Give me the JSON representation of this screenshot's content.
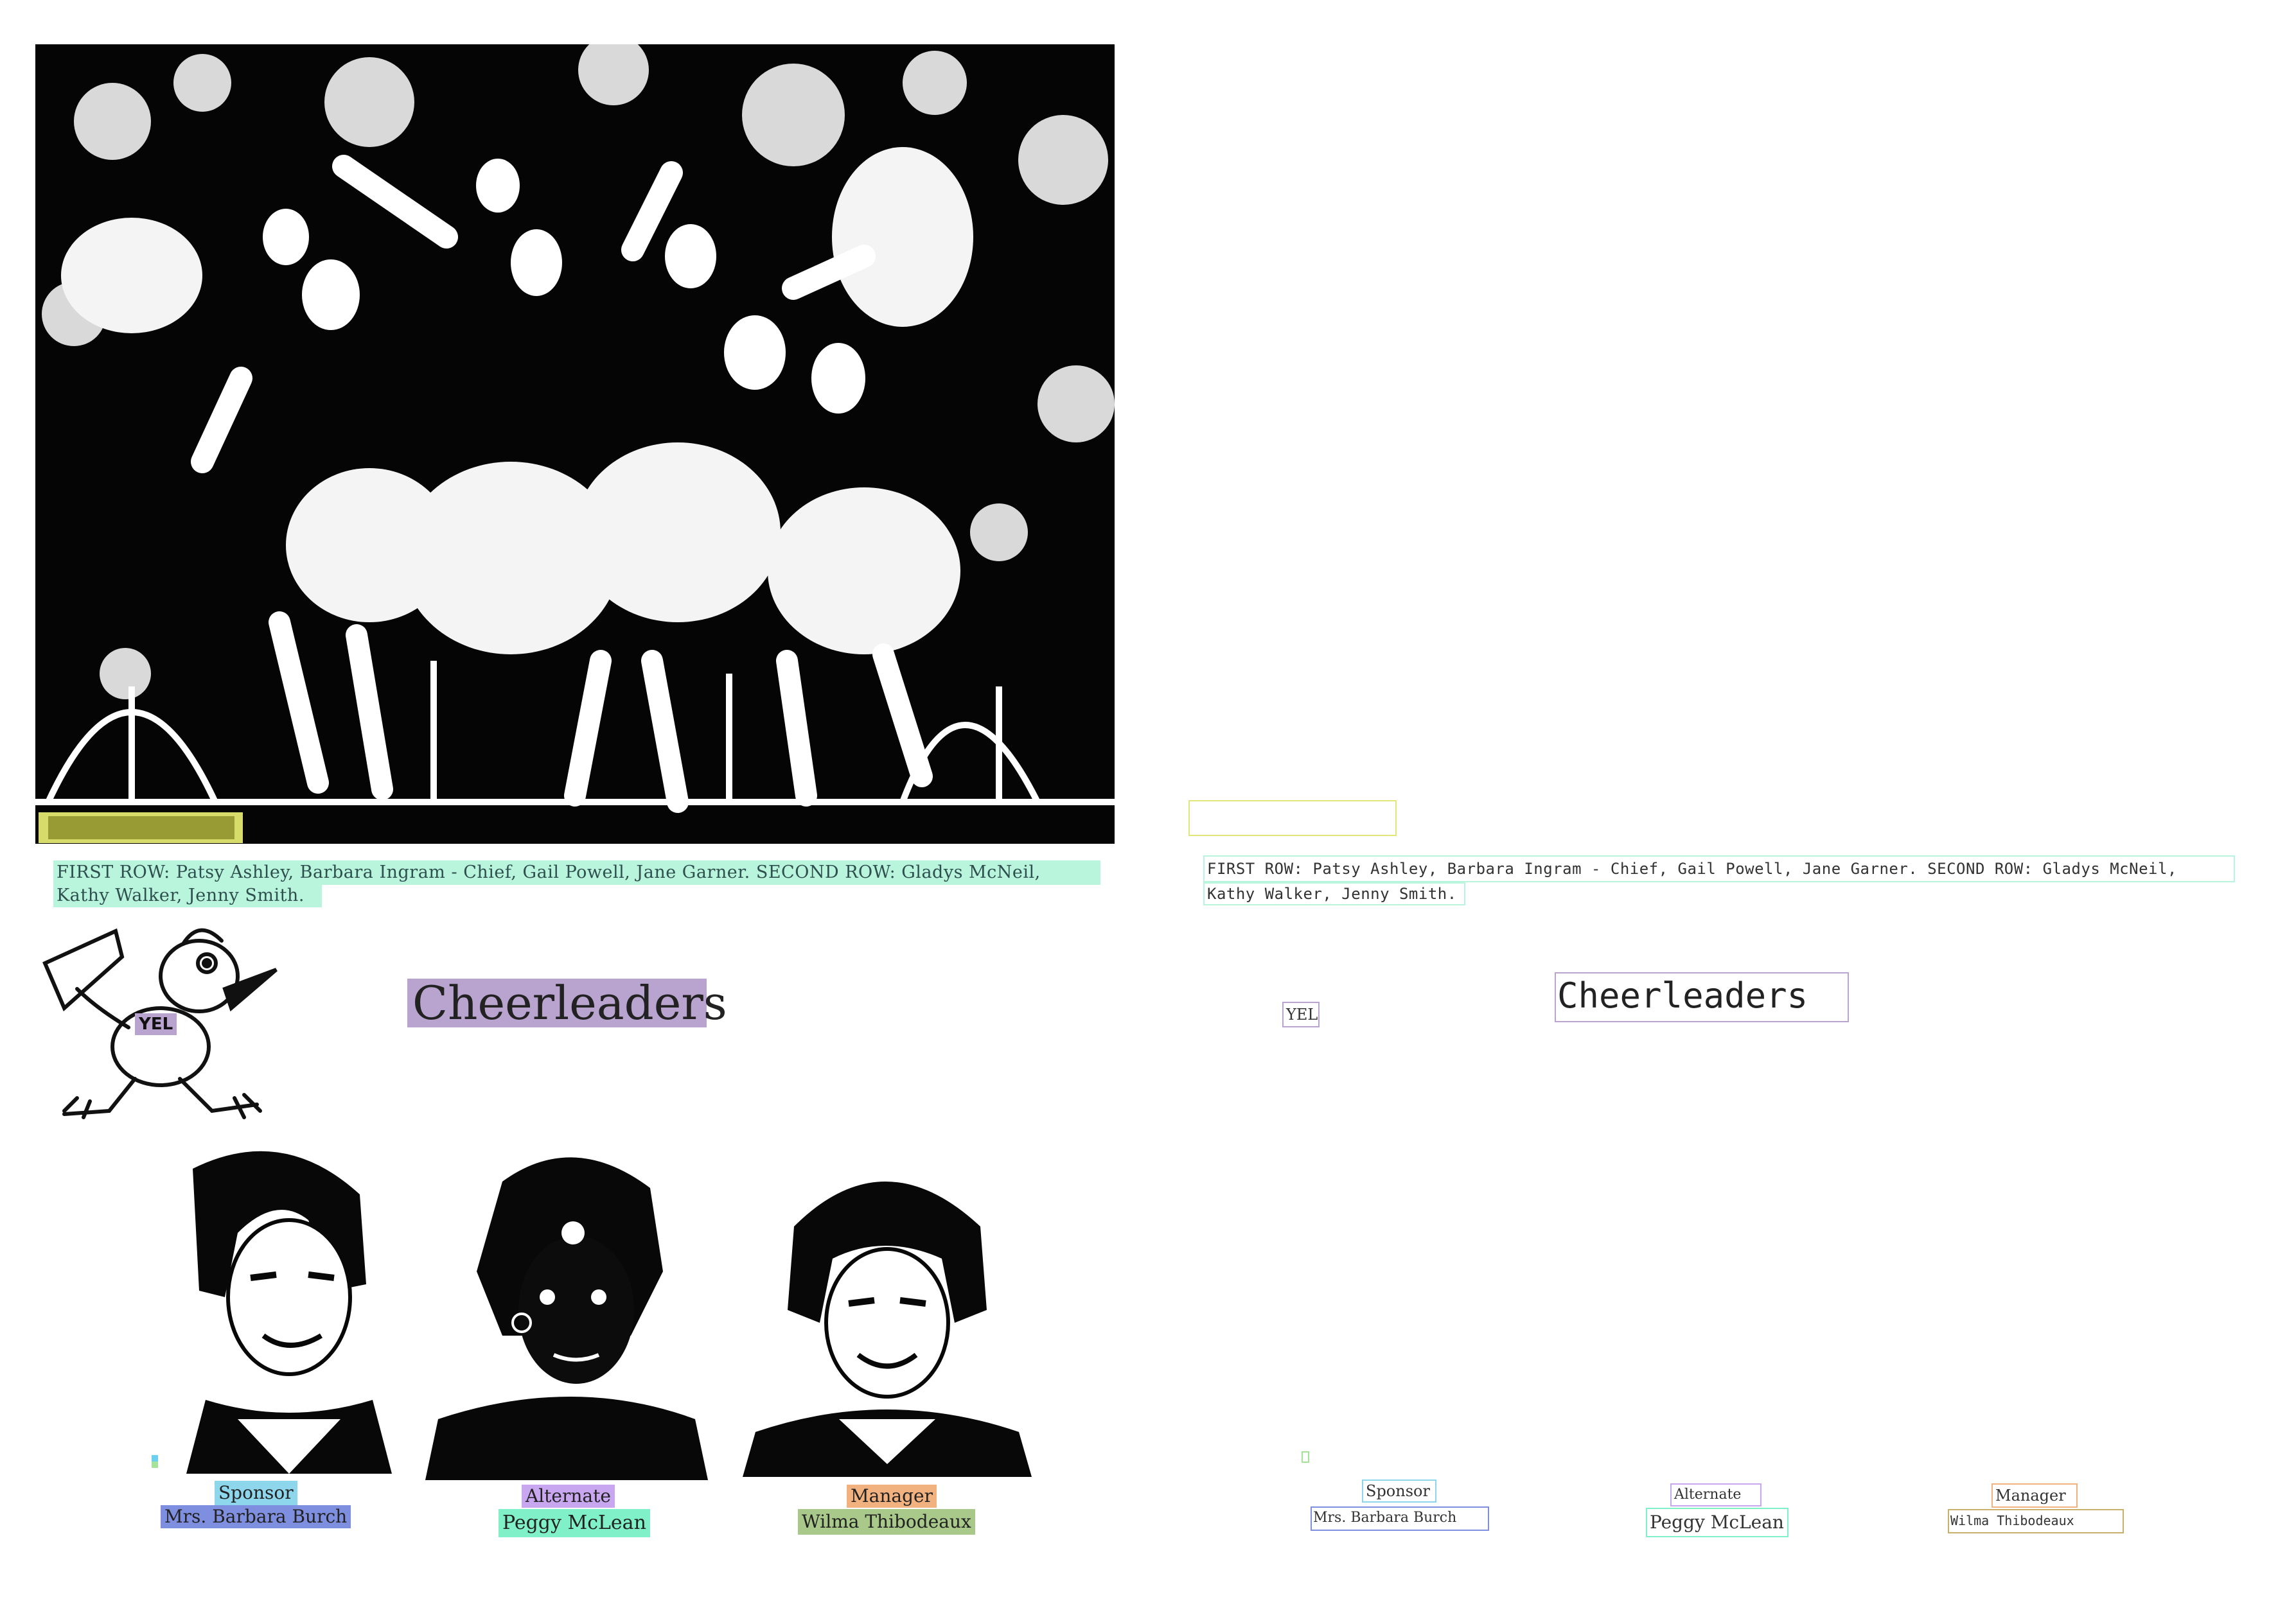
{
  "left_page": {
    "caption_line1": "FIRST ROW: Patsy Ashley, Barbara Ingram - Chief, Gail Powell, Jane Garner. SECOND ROW: Gladys McNeil,",
    "caption_line2": "Kathy Walker, Jenny Smith.",
    "mascot_shirt": "YEL",
    "title": "Cheerleaders",
    "portraits": [
      {
        "role": "Sponsor",
        "name": "Mrs. Barbara Burch"
      },
      {
        "role": "Alternate",
        "name": "Peggy McLean"
      },
      {
        "role": "Manager",
        "name": "Wilma Thibodeaux"
      }
    ]
  },
  "right_page": {
    "caption_line1": "FIRST ROW: Patsy Ashley, Barbara Ingram - Chief, Gail Powell, Jane Garner. SECOND ROW: Gladys McNeil,",
    "caption_line2": "Kathy Walker, Jenny Smith.",
    "mascot_shirt": "YEL",
    "title": "Cheerleaders",
    "portraits": [
      {
        "role": "Sponsor",
        "name": "Mrs. Barbara Burch"
      },
      {
        "role": "Alternate",
        "name": "Peggy McLean"
      },
      {
        "role": "Manager",
        "name": "Wilma Thibodeaux"
      }
    ]
  },
  "colors": {
    "caption_highlight": "#b9f5dc",
    "title_highlight": "#b9a3cf",
    "sponsor_highlight": "#8ed6ec",
    "sponsor_name_highlight": "#7f8fe0",
    "alternate_highlight": "#c9a6f0",
    "alternate_name_highlight": "#7ff0c8",
    "manager_highlight": "#f2b27f",
    "manager_name_highlight": "#a9c98a"
  }
}
